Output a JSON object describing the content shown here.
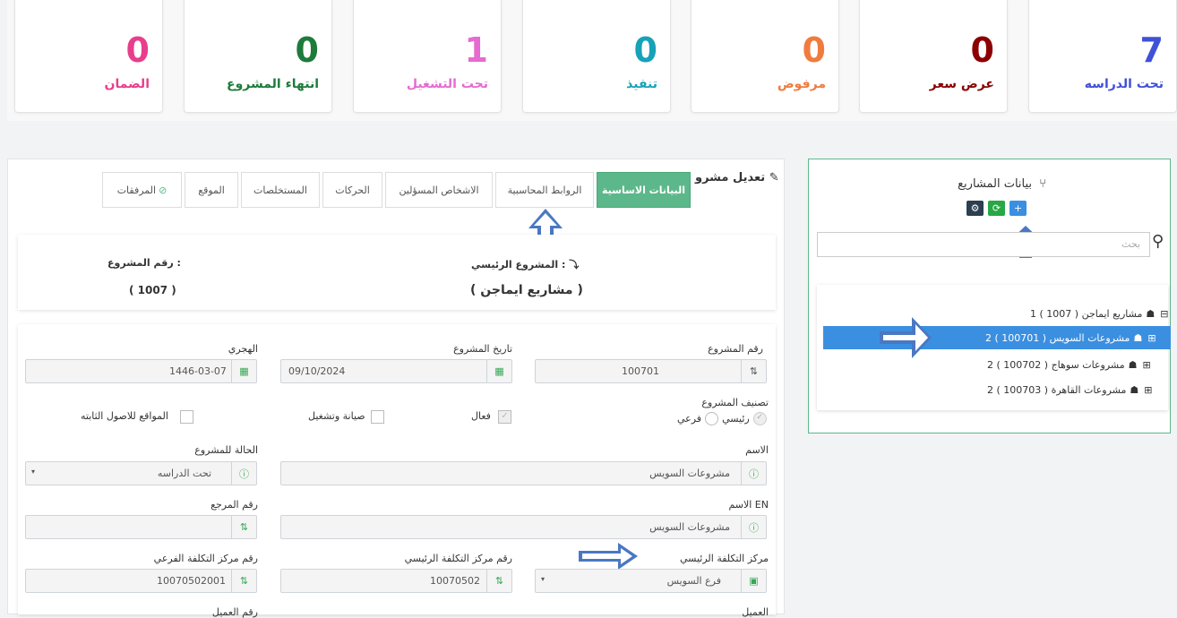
{
  "stats": [
    {
      "value": "0",
      "label": "الضمان",
      "color": "#e83e8c"
    },
    {
      "value": "0",
      "label": "انتهاء المشروع",
      "color": "#1e7b3c"
    },
    {
      "value": "1",
      "label": "تحت التشغيل",
      "color": "#e56bd0"
    },
    {
      "value": "0",
      "label": "تنفيذ",
      "color": "#17a2b8"
    },
    {
      "value": "0",
      "label": "مرفوض",
      "color": "#f07b3f"
    },
    {
      "value": "0",
      "label": "عرض سعر",
      "color": "#8b0000"
    },
    {
      "value": "7",
      "label": "تحت الدراسه",
      "color": "#3f51d8"
    }
  ],
  "tree_panel": {
    "title": "بيانات المشاريع",
    "search_placeholder": "بحث",
    "items": [
      {
        "label": "مشاريع ايماجن ( 1007 ) 1",
        "toggle": "⊟"
      },
      {
        "label": "مشروعات السويس ( 100701 ) 2",
        "toggle": "⊞"
      },
      {
        "label": "مشروعات سوهاج ( 100702 ) 2",
        "toggle": "⊞"
      },
      {
        "label": "مشروعات القاهرة ( 100703 ) 2",
        "toggle": "⊞"
      }
    ]
  },
  "form": {
    "title": "تعديل مشرو",
    "tabs": [
      "البيانات الاساسية",
      "الروابط المحاسبية",
      "الاشخاص المسؤلين",
      "الحركات",
      "المستخلصات",
      "الموقع",
      "المرفقات"
    ],
    "project_number_label": "رقم المشروع :",
    "project_number_value": "( 1007 )",
    "parent_project_label": "المشروع الرئيسي :",
    "parent_project_value": "( مشاريع ايماجن )",
    "fields": {
      "project_no_label": "رقم المشروع",
      "project_no_value": "100701",
      "project_date_label": "تاريخ المشروع",
      "project_date_value": "09/10/2024",
      "hijri_label": "الهجري",
      "hijri_value": "1446-03-07",
      "classification_label": "تصنيف المشروع",
      "main_label": "رئيسي",
      "sub_label": "فرعي",
      "active_label": "فعال",
      "maintenance_label": "صيانة وتشغيل",
      "fixed_assets_label": "المواقع للاصول الثابته",
      "name_label": "الاسم",
      "name_value": "مشروعات السويس",
      "status_label": "الحالة للمشروع",
      "status_value": "تحت الدراسه",
      "name_en_label": "الاسم EN",
      "name_en_value": "مشروعات السويس",
      "ref_label": "رقم المرجع",
      "main_cost_center_label": "مركز التكلفة الرئيسي",
      "main_cost_center_value": "فرع السويس",
      "main_cost_no_label": "رقم مركز التكلفة الرئيسي",
      "main_cost_no_value": "10070502",
      "sub_cost_no_label": "رقم مركز التكلفة الفرعي",
      "sub_cost_no_value": "10070502001",
      "client_label": "العميل",
      "client_no_label": "رقم العميل"
    }
  }
}
